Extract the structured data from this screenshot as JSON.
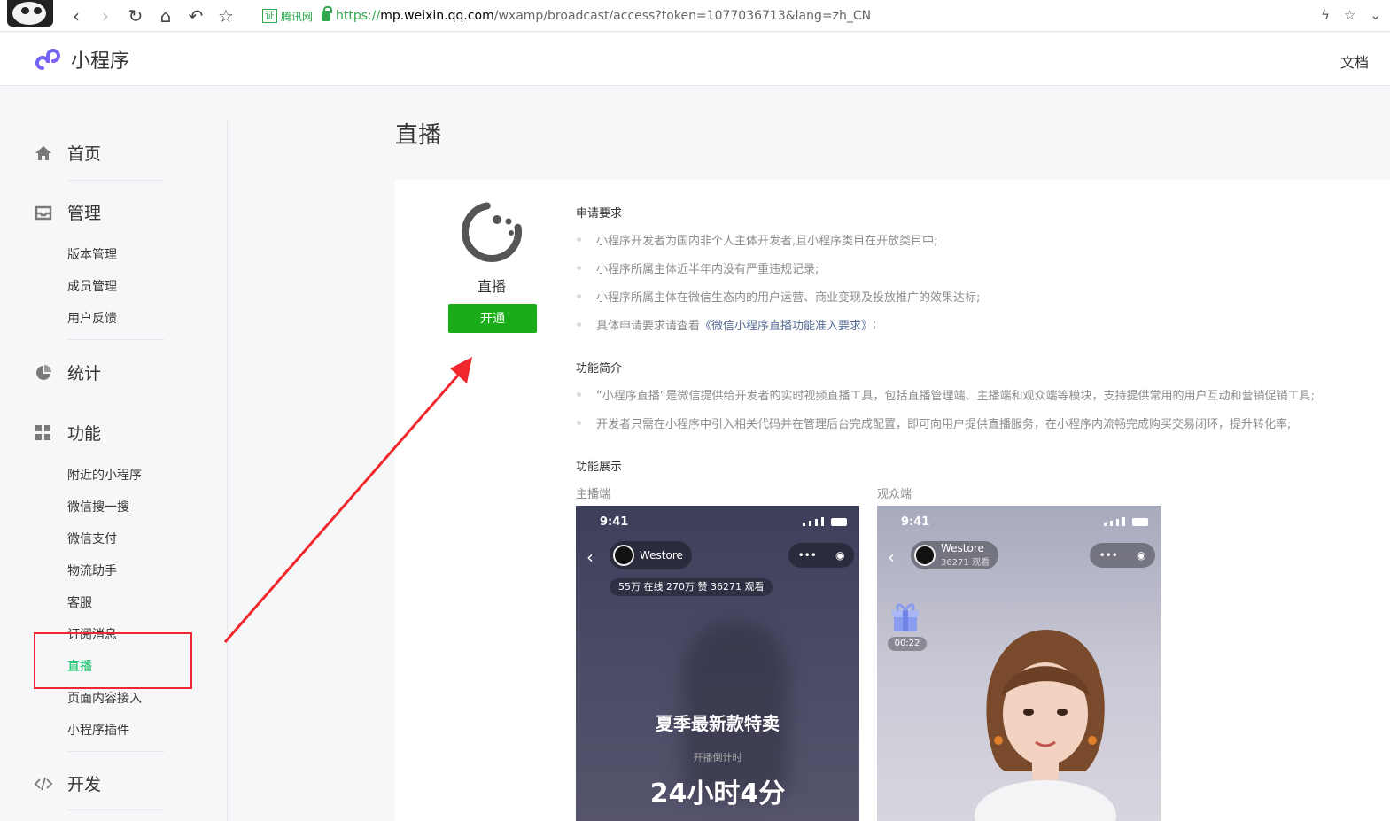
{
  "browser": {
    "cert_badge": "证",
    "cert_label": "腾讯网",
    "url_scheme": "https://",
    "url_host": "mp.weixin.qq.com",
    "url_rest": "/wxamp/broadcast/access?token=1077036713&lang=zh_CN"
  },
  "header": {
    "brand": "小程序",
    "docs": "文档"
  },
  "sidebar": {
    "home": "首页",
    "manage": "管理",
    "manage_items": [
      "版本管理",
      "成员管理",
      "用户反馈"
    ],
    "stats": "统计",
    "features": "功能",
    "feature_items": [
      "附近的小程序",
      "微信搜一搜",
      "微信支付",
      "物流助手",
      "客服",
      "订阅消息",
      "直播",
      "页面内容接入",
      "小程序插件"
    ],
    "develop": "开发"
  },
  "main": {
    "title": "直播",
    "service_name": "直播",
    "open_button": "开通",
    "requirements": {
      "title": "申请要求",
      "items": [
        "小程序开发者为国内非个人主体开发者,且小程序类目在开放类目中;",
        "小程序所属主体近半年内没有严重违规记录;",
        "小程序所属主体在微信生态内的用户运营、商业变现及投放推广的效果达标;"
      ],
      "last_prefix": "具体申请要求请查看",
      "last_link": "《微信小程序直播功能准入要求》",
      "last_suffix": ";"
    },
    "intro": {
      "title": "功能简介",
      "items": [
        "“小程序直播”是微信提供给开发者的实时视频直播工具，包括直播管理端、主播端和观众端等模块，支持提供常用的用户互动和营销促销工具;",
        "开发者只需在小程序中引入相关代码并在管理后台完成配置，即可向用户提供直播服务，在小程序内流畅完成购买交易闭环，提升转化率;"
      ]
    },
    "showcase": {
      "title": "功能展示",
      "host_label": "主播端",
      "viewer_label": "观众端"
    },
    "host_phone": {
      "time": "9:41",
      "name": "Westore",
      "stats": "55万 在线  270万 赞  36271 观看",
      "promo": "夏季最新款特卖",
      "countdown_label": "开播倒计时",
      "countdown": "24小时4分"
    },
    "viewer_phone": {
      "time": "9:41",
      "name": "Westore",
      "views": "36271 观看",
      "gift_timer": "00:22"
    }
  },
  "colors": {
    "accent_green": "#1aad19",
    "active_green": "#07c160",
    "annotation_red": "#f0282d",
    "link_blue": "#576b95"
  }
}
